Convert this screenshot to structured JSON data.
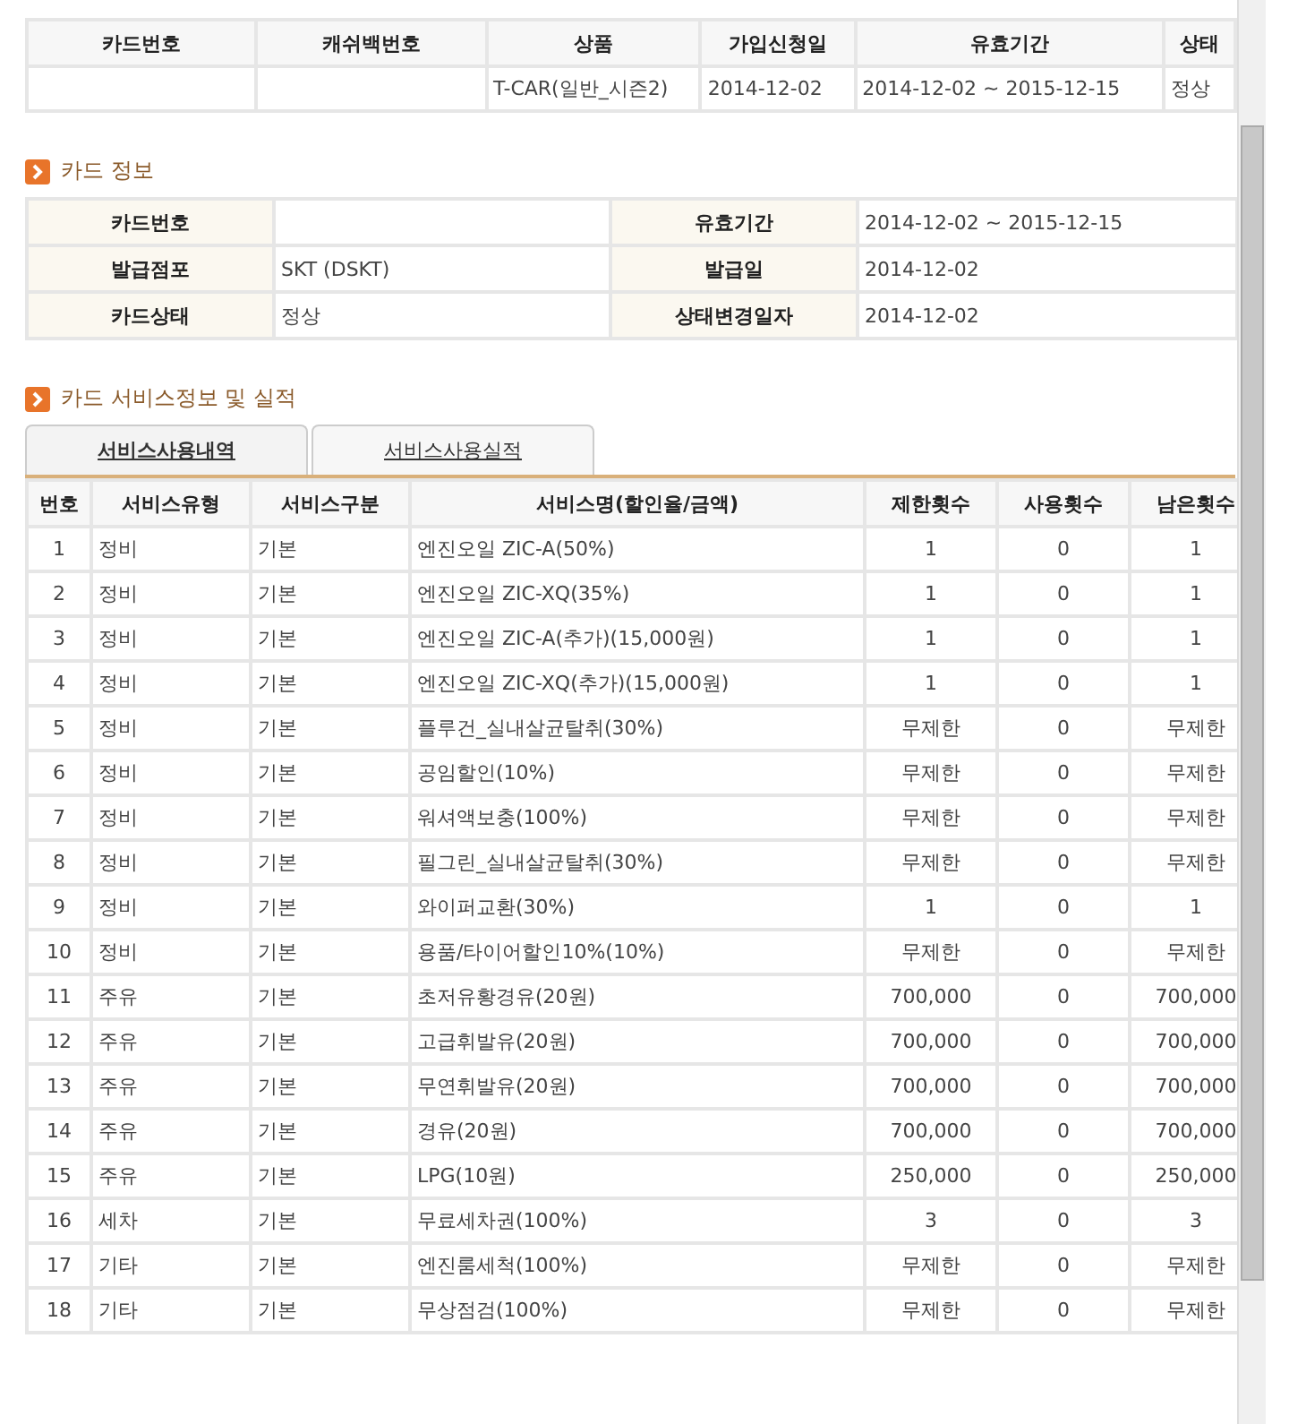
{
  "owned_cards": {
    "columns": [
      "카드번호",
      "캐쉬백번호",
      "상품",
      "가입신청일",
      "유효기간",
      "상태"
    ],
    "rows": [
      [
        "",
        "",
        "T-CAR(일반_시즌2)",
        "2014-12-02",
        "2014-12-02 ~ 2015-12-15",
        "정상"
      ]
    ]
  },
  "card_info": {
    "title": "카드 정보",
    "rows": [
      {
        "label": "카드번호",
        "value": "",
        "label_2": "유효기간",
        "value_2": "2014-12-02 ~ 2015-12-15"
      },
      {
        "label": "발급점포",
        "value": "SKT (DSKT)",
        "label_2": "발급일",
        "value_2": "2014-12-02"
      },
      {
        "label": "카드상태",
        "value": "정상",
        "label_2": "상태변경일자",
        "value_2": "2014-12-02"
      }
    ]
  },
  "service": {
    "title": "카드 서비스정보 및 실적",
    "tabs": [
      {
        "label": "서비스사용내역",
        "selected": true
      },
      {
        "label": "서비스사용실적",
        "selected": false
      }
    ],
    "columns": [
      "번호",
      "서비스유형",
      "서비스구분",
      "서비스명(할인율/금액)",
      "제한횟수",
      "사용횟수",
      "남은횟수"
    ],
    "rows": [
      [
        "1",
        "정비",
        "기본",
        "엔진오일 ZIC-A(50%)",
        "1",
        "0",
        "1"
      ],
      [
        "2",
        "정비",
        "기본",
        "엔진오일 ZIC-XQ(35%)",
        "1",
        "0",
        "1"
      ],
      [
        "3",
        "정비",
        "기본",
        "엔진오일 ZIC-A(추가)(15,000원)",
        "1",
        "0",
        "1"
      ],
      [
        "4",
        "정비",
        "기본",
        "엔진오일 ZIC-XQ(추가)(15,000원)",
        "1",
        "0",
        "1"
      ],
      [
        "5",
        "정비",
        "기본",
        "플루건_실내살균탈취(30%)",
        "무제한",
        "0",
        "무제한"
      ],
      [
        "6",
        "정비",
        "기본",
        "공임할인(10%)",
        "무제한",
        "0",
        "무제한"
      ],
      [
        "7",
        "정비",
        "기본",
        "워셔액보충(100%)",
        "무제한",
        "0",
        "무제한"
      ],
      [
        "8",
        "정비",
        "기본",
        "필그린_실내살균탈취(30%)",
        "무제한",
        "0",
        "무제한"
      ],
      [
        "9",
        "정비",
        "기본",
        "와이퍼교환(30%)",
        "1",
        "0",
        "1"
      ],
      [
        "10",
        "정비",
        "기본",
        "용품/타이어할인10%(10%)",
        "무제한",
        "0",
        "무제한"
      ],
      [
        "11",
        "주유",
        "기본",
        "초저유황경유(20원)",
        "700,000",
        "0",
        "700,000"
      ],
      [
        "12",
        "주유",
        "기본",
        "고급휘발유(20원)",
        "700,000",
        "0",
        "700,000"
      ],
      [
        "13",
        "주유",
        "기본",
        "무연휘발유(20원)",
        "700,000",
        "0",
        "700,000"
      ],
      [
        "14",
        "주유",
        "기본",
        "경유(20원)",
        "700,000",
        "0",
        "700,000"
      ],
      [
        "15",
        "주유",
        "기본",
        "LPG(10원)",
        "250,000",
        "0",
        "250,000"
      ],
      [
        "16",
        "세차",
        "기본",
        "무료세차권(100%)",
        "3",
        "0",
        "3"
      ],
      [
        "17",
        "기타",
        "기본",
        "엔진룸세척(100%)",
        "무제한",
        "0",
        "무제한"
      ],
      [
        "18",
        "기타",
        "기본",
        "무상점검(100%)",
        "무제한",
        "0",
        "무제한"
      ]
    ]
  }
}
